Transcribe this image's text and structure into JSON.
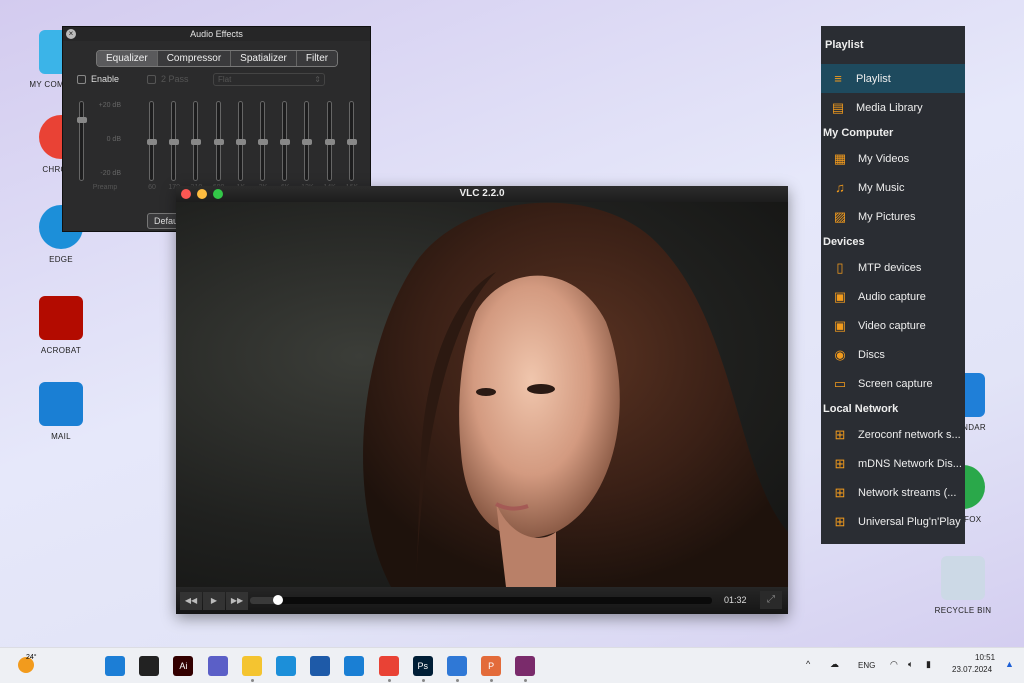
{
  "desktop": {
    "left_icons": [
      {
        "label": "MY COMPUTER",
        "color": "#3bb4e8"
      },
      {
        "label": "CHROME",
        "color": "#e94235"
      },
      {
        "label": "EDGE",
        "color": "#1c8fd9"
      },
      {
        "label": "ACROBAT",
        "color": "#b30b00"
      },
      {
        "label": "MAIL",
        "color": "#1a7fd4"
      }
    ],
    "right_icons": [
      {
        "label": "CALENDAR",
        "color": "#1f7fd8"
      },
      {
        "label": "FIREFOX",
        "color": "#2aa84a"
      },
      {
        "label": "RECYCLE BIN",
        "color": "#ccd9e6"
      }
    ]
  },
  "audio_effects": {
    "title": "Audio Effects",
    "tabs": [
      "Equalizer",
      "Compressor",
      "Spatializer",
      "Filter"
    ],
    "active_tab": "Equalizer",
    "enable_label": "Enable",
    "enable_checked": false,
    "two_pass_label": "2 Pass",
    "two_pass_checked": false,
    "preset": "Flat",
    "db_labels": [
      "+20 dB",
      "0 dB",
      "-20 dB"
    ],
    "preamp_label": "Preamp",
    "preamp_db": 12,
    "bands": [
      "60",
      "170",
      "310",
      "600",
      "1K",
      "3K",
      "6K",
      "12K",
      "14K",
      "16K"
    ],
    "band_values_db": [
      0,
      0,
      0,
      0,
      0,
      0,
      0,
      0,
      0,
      0
    ],
    "default_button": "Default"
  },
  "vlc": {
    "title": "VLC 2.2.0",
    "time": "01:32",
    "progress": 0.06,
    "buttons": {
      "rewind": "◀◀",
      "play": "▶",
      "forward": "▶▶",
      "fullscreen": "⤢"
    }
  },
  "playlist": {
    "title": "Playlist",
    "items": [
      {
        "label": "Playlist",
        "icon": "≡",
        "active": true
      },
      {
        "label": "Media Library",
        "icon": "▤"
      }
    ],
    "sections": [
      {
        "title": "My Computer",
        "items": [
          {
            "label": "My Videos",
            "icon": "▦"
          },
          {
            "label": "My Music",
            "icon": "♫"
          },
          {
            "label": "My Pictures",
            "icon": "▨"
          }
        ]
      },
      {
        "title": "Devices",
        "items": [
          {
            "label": "MTP devices",
            "icon": "▯"
          },
          {
            "label": "Audio capture",
            "icon": "▣"
          },
          {
            "label": "Video capture",
            "icon": "▣"
          },
          {
            "label": "Discs",
            "icon": "◉"
          },
          {
            "label": "Screen capture",
            "icon": "▭"
          }
        ]
      },
      {
        "title": "Local Network",
        "items": [
          {
            "label": "Zeroconf network s...",
            "icon": "⊞"
          },
          {
            "label": "mDNS Network Dis...",
            "icon": "⊞"
          },
          {
            "label": "Network streams (...",
            "icon": "⊞"
          },
          {
            "label": "Universal Plug'n'Play",
            "icon": "⊞"
          }
        ]
      }
    ]
  },
  "taskbar": {
    "weather": "24°",
    "apps": [
      {
        "name": "start",
        "color": "#1c7ed6"
      },
      {
        "name": "task-view",
        "color": "#222"
      },
      {
        "name": "illustrator",
        "color": "#330000",
        "text": "Ai"
      },
      {
        "name": "teams",
        "color": "#5b5fc7"
      },
      {
        "name": "file-explorer",
        "color": "#f4c430"
      },
      {
        "name": "edge",
        "color": "#1c8fd9"
      },
      {
        "name": "store",
        "color": "#1e5aa8"
      },
      {
        "name": "mail",
        "color": "#1a7fd4"
      },
      {
        "name": "chrome",
        "color": "#e94235"
      },
      {
        "name": "photoshop",
        "color": "#001e36",
        "text": "Ps"
      },
      {
        "name": "photos",
        "color": "#2f78d6"
      },
      {
        "name": "powerpoint",
        "color": "#e36b3a",
        "text": "P"
      },
      {
        "name": "winrar",
        "color": "#7a2b6b"
      }
    ],
    "tray": {
      "chevron": "^",
      "lang": "ENG",
      "time": "10:51",
      "date": "23.07.2024"
    }
  }
}
